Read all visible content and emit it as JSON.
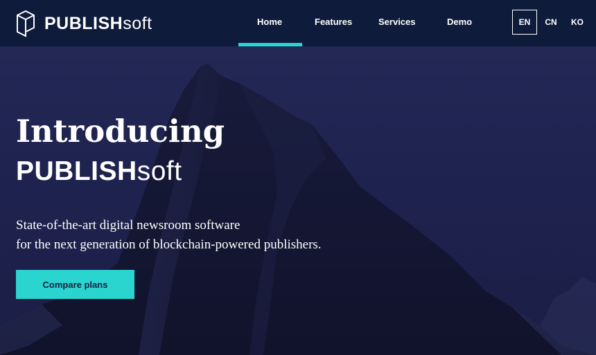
{
  "brand": {
    "name_bold": "PUBLISH",
    "name_light": "soft"
  },
  "nav": {
    "items": [
      {
        "label": "Home",
        "active": true
      },
      {
        "label": "Features",
        "active": false
      },
      {
        "label": "Services",
        "active": false
      },
      {
        "label": "Demo",
        "active": false
      }
    ]
  },
  "languages": {
    "items": [
      {
        "label": "EN",
        "selected": true
      },
      {
        "label": "CN",
        "selected": false
      },
      {
        "label": "KO",
        "selected": false
      }
    ]
  },
  "hero": {
    "headline": "Introducing",
    "brand_bold": "PUBLISH",
    "brand_light": "soft",
    "subtext_line1": "State-of-the-art digital newsroom software",
    "subtext_line2": "for the next generation of blockchain-powered publishers.",
    "cta_label": "Compare plans"
  },
  "colors": {
    "navbar": "#0e1b3a",
    "accent": "#29d6d1",
    "hero_overlay": "#1f2147",
    "cta_text": "#1a1f3f"
  }
}
